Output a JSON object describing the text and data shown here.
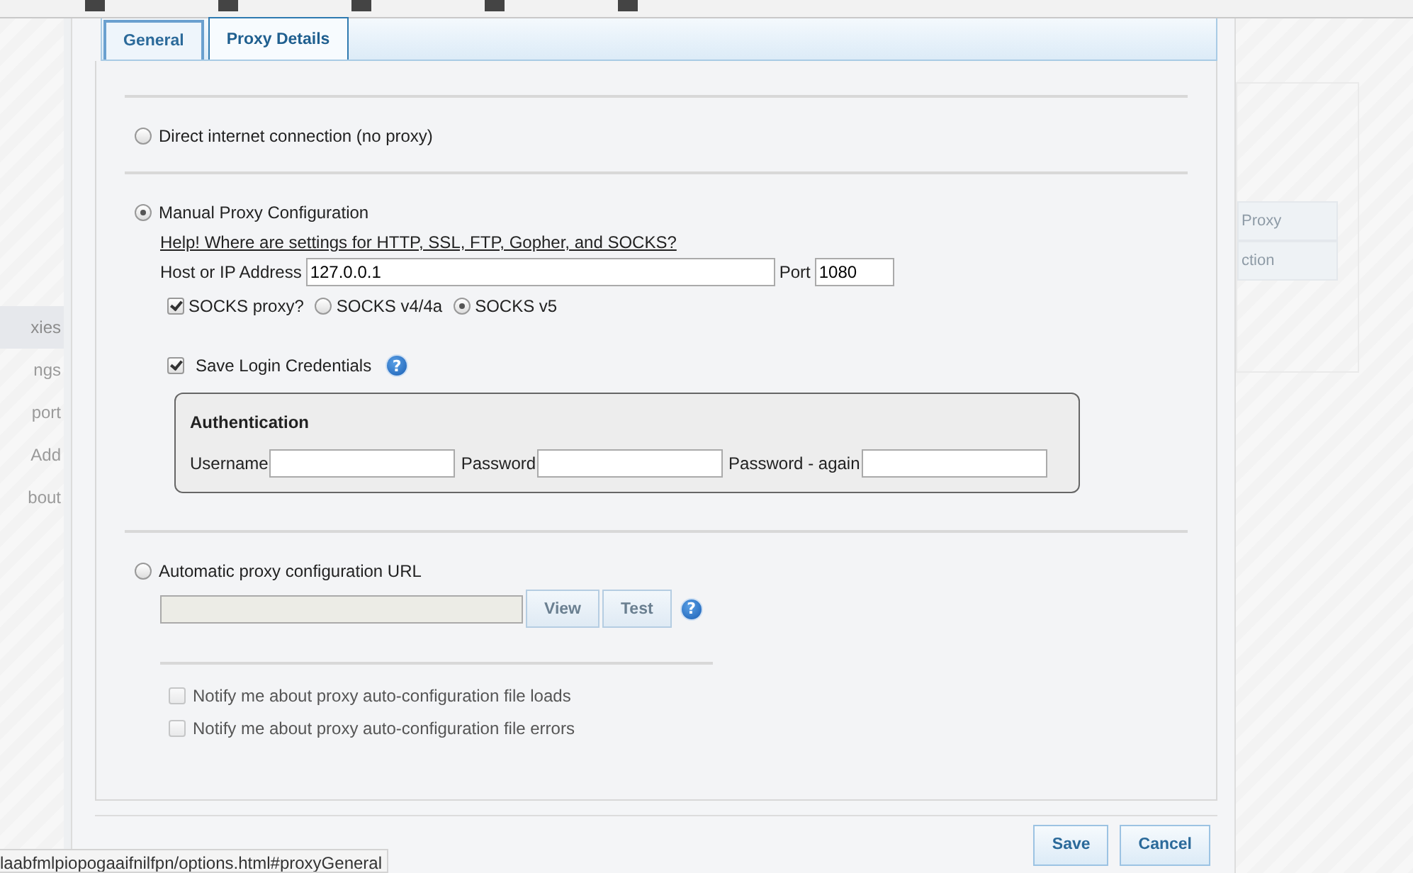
{
  "background_sidebar": {
    "items": [
      {
        "label": "xies",
        "selected": true
      },
      {
        "label": "ngs",
        "selected": false
      },
      {
        "label": "port",
        "selected": false
      },
      {
        "label": "Add",
        "selected": false
      },
      {
        "label": "bout",
        "selected": false
      }
    ]
  },
  "background_panel": {
    "items": [
      "Proxy",
      "ction"
    ]
  },
  "tabs": [
    {
      "label": "General",
      "selected": false
    },
    {
      "label": "Proxy Details",
      "selected": true
    }
  ],
  "direct": {
    "label": "Direct internet connection (no proxy)",
    "selected": false
  },
  "manual": {
    "label": "Manual Proxy Configuration",
    "selected": true,
    "help_link": "Help! Where are settings for HTTP, SSL, FTP, Gopher, and SOCKS?",
    "host_label": "Host or IP Address",
    "host_value": "127.0.0.1",
    "port_label": "Port",
    "port_value": "1080",
    "socks_proxy": {
      "label": "SOCKS proxy?",
      "checked": true
    },
    "socks_versions": [
      {
        "label": "SOCKS v4/4a",
        "selected": false
      },
      {
        "label": "SOCKS v5",
        "selected": true
      }
    ],
    "save_login": {
      "label": "Save Login Credentials",
      "checked": true,
      "help_icon": "?"
    },
    "authentication": {
      "title": "Authentication",
      "fields": [
        {
          "label": "Username"
        },
        {
          "label": "Password"
        },
        {
          "label": "Password - again"
        }
      ]
    }
  },
  "auto": {
    "label": "Automatic proxy configuration URL",
    "selected": false,
    "buttons": [
      "View",
      "Test"
    ],
    "help_icon": "?",
    "notify": [
      {
        "label": "Notify me about proxy auto-configuration file loads",
        "checked": false,
        "disabled": true
      },
      {
        "label": "Notify me about proxy auto-configuration file errors",
        "checked": false,
        "disabled": true
      }
    ]
  },
  "footer_buttons": [
    "Save",
    "Cancel"
  ],
  "status_bar": "laabfmlpiopogaaifnilfpn/options.html#proxyGeneral"
}
